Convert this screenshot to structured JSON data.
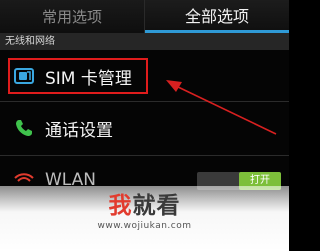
{
  "tabs": {
    "common": "常用选项",
    "all": "全部选项"
  },
  "section": {
    "wireless": "无线和网络"
  },
  "rows": {
    "sim": "SIM 卡管理",
    "call": "通话设置",
    "wlan": "WLAN"
  },
  "wlan_toggle": {
    "on_label": "打开"
  },
  "watermark": {
    "brand_part1": "我",
    "brand_part2": "就看",
    "url": "www.wojiukan.com"
  },
  "colors": {
    "accent_tab": "#2f9ad6",
    "highlight": "#e01c1c",
    "sim_icon": "#3aa7e0",
    "call_icon": "#3fc24c",
    "toggle_on": "#7dbf3a"
  },
  "icons": {
    "sim": "sim-card-icon",
    "call": "phone-icon",
    "wlan": "wifi-icon"
  }
}
